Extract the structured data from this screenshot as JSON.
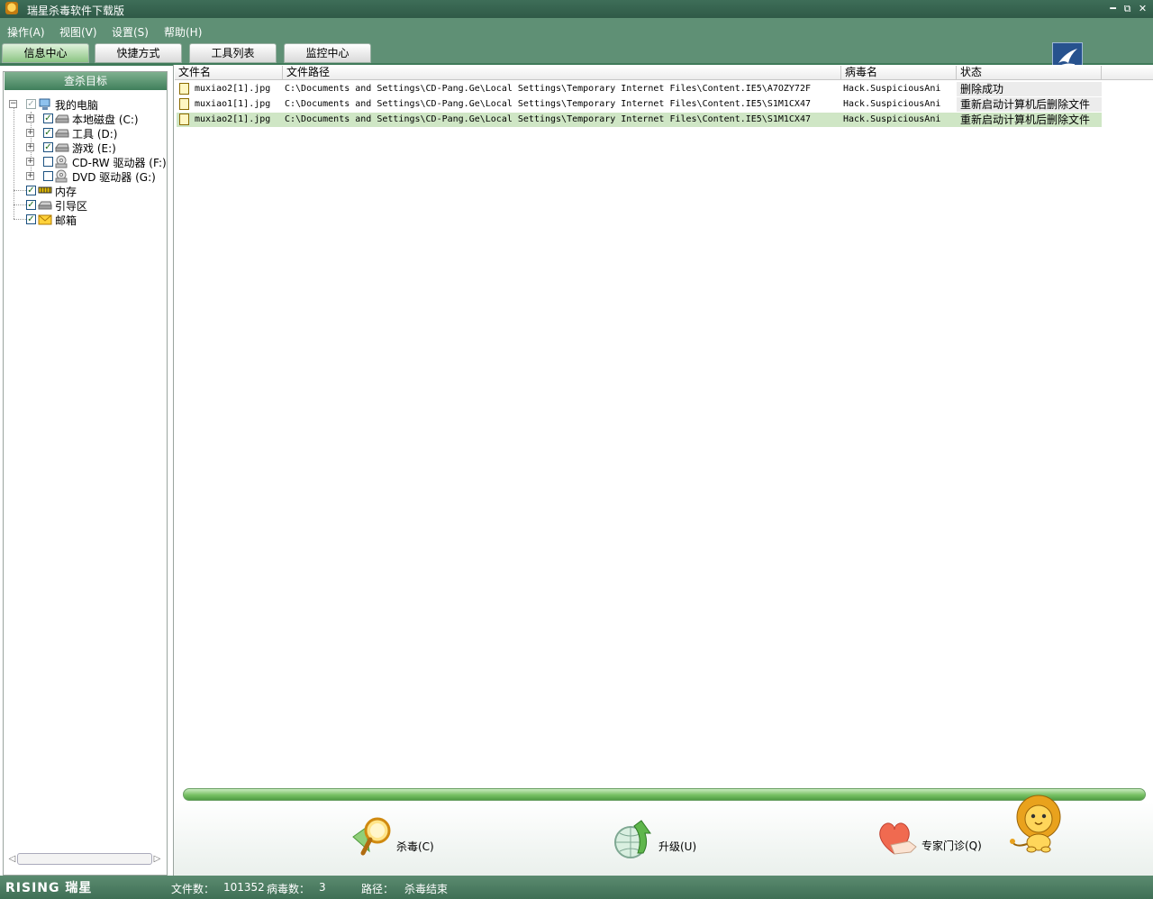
{
  "window": {
    "title": "瑞星杀毒软件下载版"
  },
  "menu": [
    "操作(A)",
    "视图(V)",
    "设置(S)",
    "帮助(H)"
  ],
  "tabs": [
    {
      "label": "信息中心",
      "active": true
    },
    {
      "label": "快捷方式",
      "active": false
    },
    {
      "label": "工具列表",
      "active": false
    },
    {
      "label": "监控中心",
      "active": false
    }
  ],
  "left_panel": {
    "header": "查杀目标",
    "tree": [
      {
        "label": "我的电脑",
        "checked": "partial",
        "icon": "computer-icon"
      },
      {
        "label": "本地磁盘 (C:)",
        "checked": true,
        "icon": "hard-disk-icon"
      },
      {
        "label": "工具 (D:)",
        "checked": true,
        "icon": "hard-disk-icon"
      },
      {
        "label": "游戏 (E:)",
        "checked": true,
        "icon": "hard-disk-icon"
      },
      {
        "label": "CD-RW 驱动器 (F:)",
        "checked": false,
        "icon": "cd-drive-icon"
      },
      {
        "label": "DVD 驱动器 (G:)",
        "checked": false,
        "icon": "dvd-drive-icon"
      },
      {
        "label": "内存",
        "checked": true,
        "icon": "memory-icon"
      },
      {
        "label": "引导区",
        "checked": true,
        "icon": "boot-sector-icon"
      },
      {
        "label": "邮箱",
        "checked": true,
        "icon": "mail-icon"
      }
    ]
  },
  "grid": {
    "columns": [
      "文件名",
      "文件路径",
      "病毒名",
      "状态"
    ],
    "rows": [
      {
        "file": "muxiao2[1].jpg",
        "path": "C:\\Documents and Settings\\CD-Pang.Ge\\Local Settings\\Temporary Internet Files\\Content.IE5\\A7OZY72F",
        "virus": "Hack.SuspiciousAni",
        "status": "删除成功"
      },
      {
        "file": "muxiao1[1].jpg",
        "path": "C:\\Documents and Settings\\CD-Pang.Ge\\Local Settings\\Temporary Internet Files\\Content.IE5\\S1M1CX47",
        "virus": "Hack.SuspiciousAni",
        "status": "重新启动计算机后删除文件"
      },
      {
        "file": "muxiao2[1].jpg",
        "path": "C:\\Documents and Settings\\CD-Pang.Ge\\Local Settings\\Temporary Internet Files\\Content.IE5\\S1M1CX47",
        "virus": "Hack.SuspiciousAni",
        "status": "重新启动计算机后删除文件",
        "selected": true
      }
    ]
  },
  "actions": {
    "scan": "杀毒(C)",
    "upgrade": "升级(U)",
    "expert": "专家门诊(Q)"
  },
  "status_bar": {
    "brand": "RISING 瑞星",
    "files_label": "文件数：",
    "files_value": "101352",
    "virus_label": "病毒数：",
    "virus_value": "3",
    "path_label": "路径：",
    "path_value": "杀毒结束"
  },
  "colors": {
    "accent": "#5f9075",
    "selected_row": "#cfe6c5",
    "progress": "#77c063"
  }
}
